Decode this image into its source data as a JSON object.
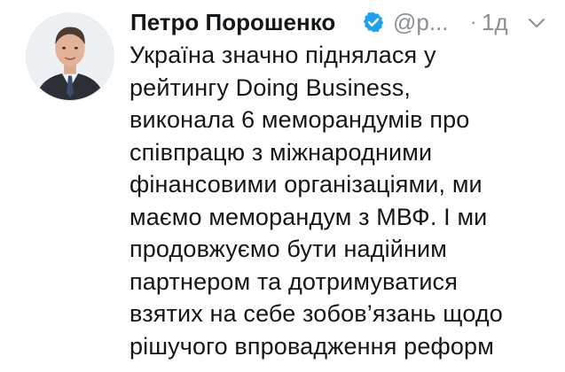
{
  "tweet": {
    "author_name": "Петро Порошенко",
    "author_handle": "@р...",
    "separator": "·",
    "timestamp": "1д",
    "verified": true,
    "accent_color": "#1da1f2",
    "text_lines": [
      "Україна значно піднялася у",
      "рейтингу Doing Business,",
      "виконала 6 меморандумів про",
      "співпрацю з міжнародними",
      "фінансовими організаціями, ми",
      "маємо меморандум з МВФ. І ми",
      "продовжуємо бути надійним",
      "партнером та дотримуватися",
      "взятих на себе зобов’язань щодо",
      "рішучого впровадження реформ"
    ]
  },
  "icons": {
    "avatar": "avatar-photo",
    "verified": "verified-badge-icon",
    "menu": "chevron-down-icon"
  }
}
